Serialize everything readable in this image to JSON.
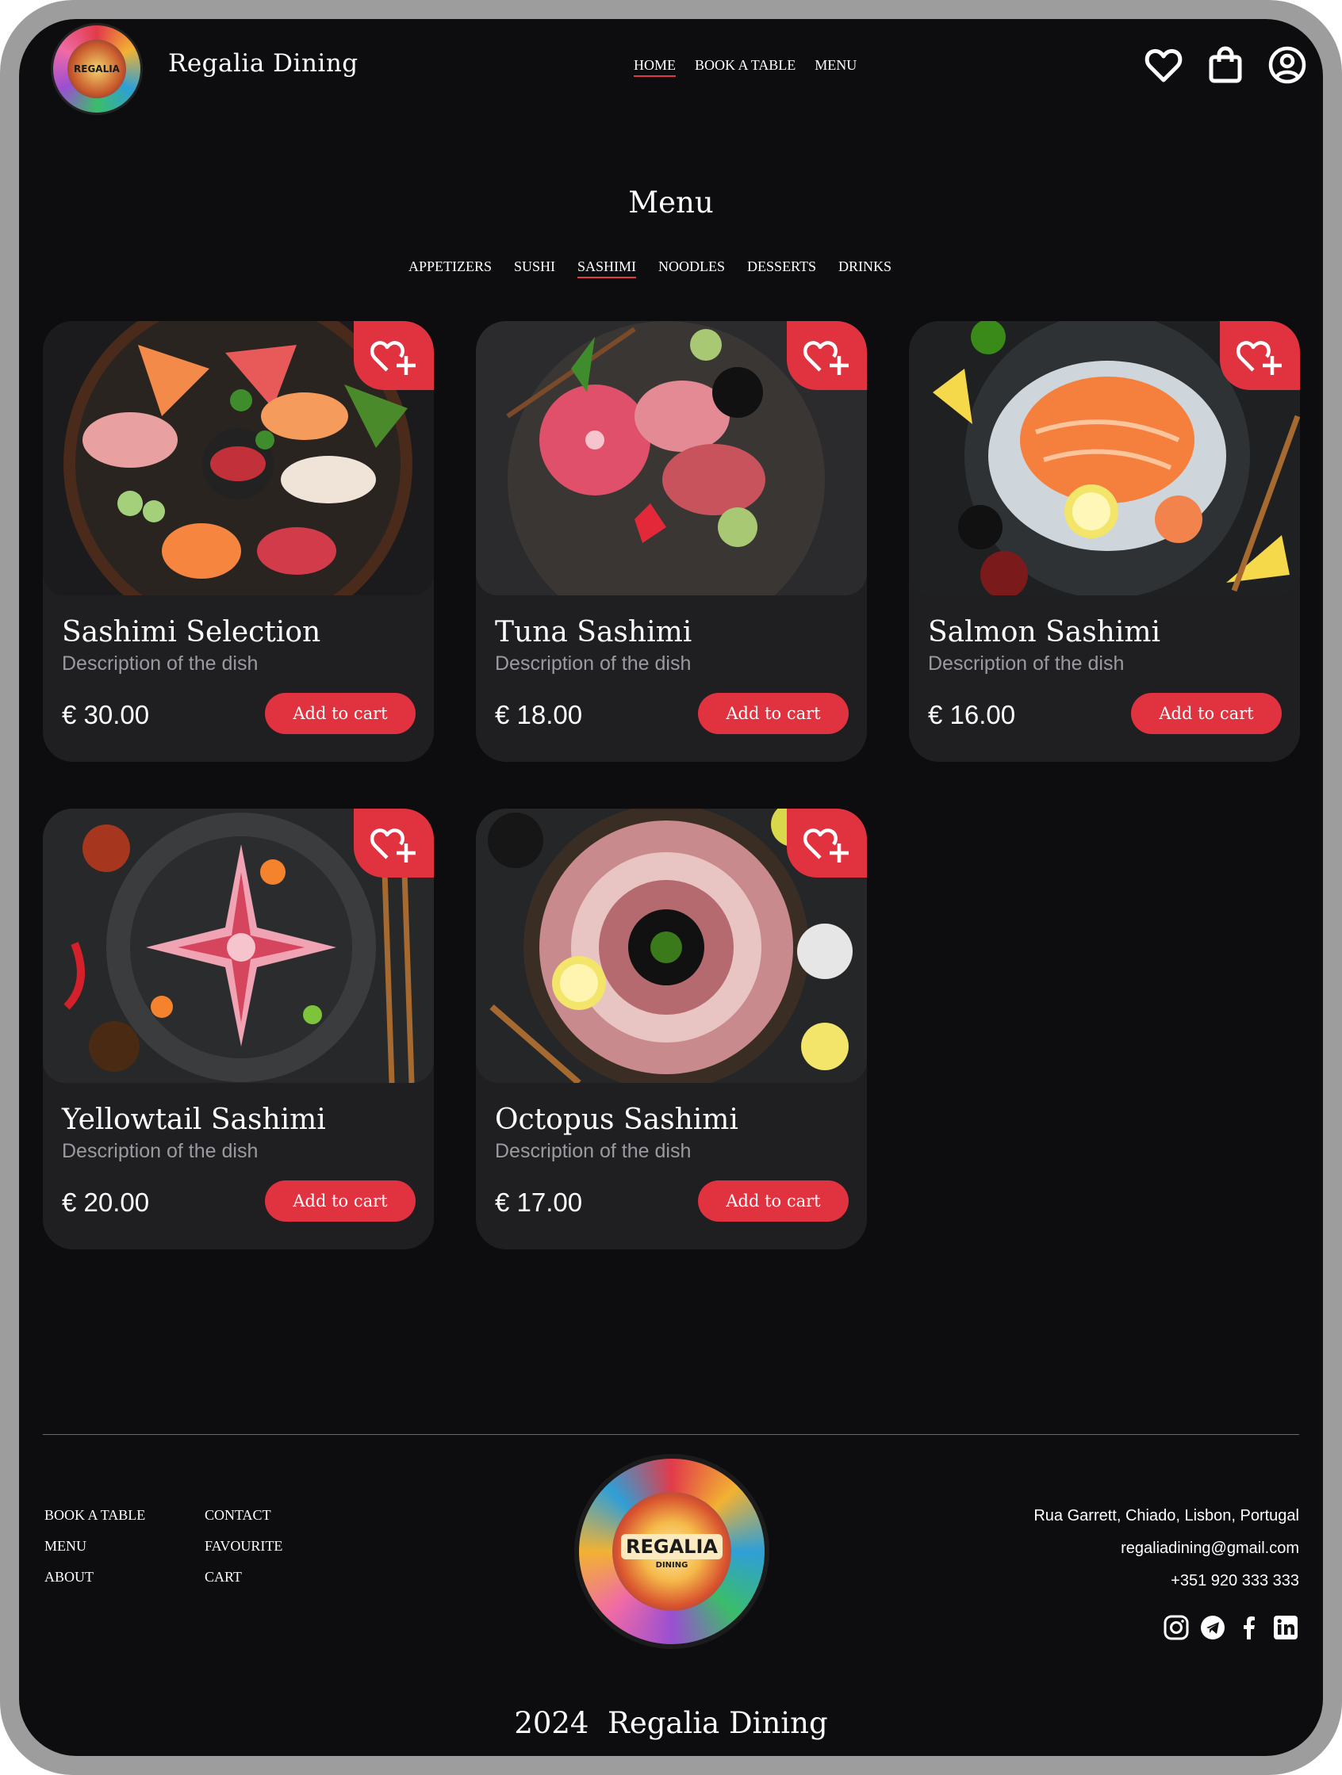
{
  "header": {
    "brand": "Regalia Dining",
    "logo_text": "REGALIA",
    "nav": [
      {
        "label": "HOME",
        "active": true
      },
      {
        "label": "BOOK A TABLE",
        "active": false
      },
      {
        "label": "MENU",
        "active": false
      }
    ],
    "icons": [
      "heart-icon",
      "shopping-bag-icon",
      "user-icon"
    ]
  },
  "menu": {
    "title": "Menu",
    "categories": [
      {
        "label": "APPETIZERS",
        "active": false
      },
      {
        "label": "SUSHI",
        "active": false
      },
      {
        "label": "SASHIMI",
        "active": true
      },
      {
        "label": "NOODLES",
        "active": false
      },
      {
        "label": "DESSERTS",
        "active": false
      },
      {
        "label": "DRINKS",
        "active": false
      }
    ]
  },
  "dishes": [
    {
      "name": "Sashimi Selection",
      "description": "Description of the dish",
      "price": "€ 30.00",
      "button": "Add to cart"
    },
    {
      "name": "Tuna Sashimi",
      "description": "Description of the dish",
      "price": "€ 18.00",
      "button": "Add to cart"
    },
    {
      "name": "Salmon Sashimi",
      "description": "Description of the dish",
      "price": "€ 16.00",
      "button": "Add to cart"
    },
    {
      "name": "Yellowtail Sashimi",
      "description": "Description of the dish",
      "price": "€ 20.00",
      "button": "Add to cart"
    },
    {
      "name": "Octopus Sashimi",
      "description": "Description of the dish",
      "price": "€ 17.00",
      "button": "Add to cart"
    }
  ],
  "footer": {
    "links_col1": [
      "BOOK A TABLE",
      "MENU",
      "ABOUT"
    ],
    "links_col2": [
      "CONTACT",
      "FAVOURITE",
      "CART"
    ],
    "logo_text": "REGALIA",
    "logo_subtext": "DINING",
    "address": "Rua Garrett, Chiado, Lisbon, Portugal",
    "email": "regaliadining@gmail.com",
    "phone": "+351 920 333 333",
    "socials": [
      "instagram-icon",
      "telegram-icon",
      "facebook-icon",
      "linkedin-icon"
    ],
    "copyright": "2024  Regalia Dining"
  },
  "colors": {
    "accent": "#e0323f",
    "background": "#0d0d0f",
    "card": "#1f1f22",
    "frame": "#9d9d9d"
  }
}
